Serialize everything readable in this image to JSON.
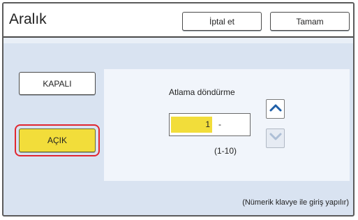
{
  "header": {
    "title": "Aralık",
    "cancel_label": "İptal et",
    "ok_label": "Tamam"
  },
  "options": {
    "off_label": "KAPALI",
    "on_label": "AÇIK",
    "selected": "on"
  },
  "panel": {
    "label": "Atlama döndürme",
    "value": "1",
    "separator": "-",
    "range": "(1-10)",
    "up_icon": "chevron-up-icon",
    "down_icon": "chevron-down-icon"
  },
  "footer": {
    "hint": "(Nümerik klavye ile giriş yapılır)"
  },
  "colors": {
    "background": "#d9e3f1",
    "selected": "#f2dd3a",
    "highlight_ring": "#e1262f",
    "accent_arrow": "#1f5fa8"
  }
}
